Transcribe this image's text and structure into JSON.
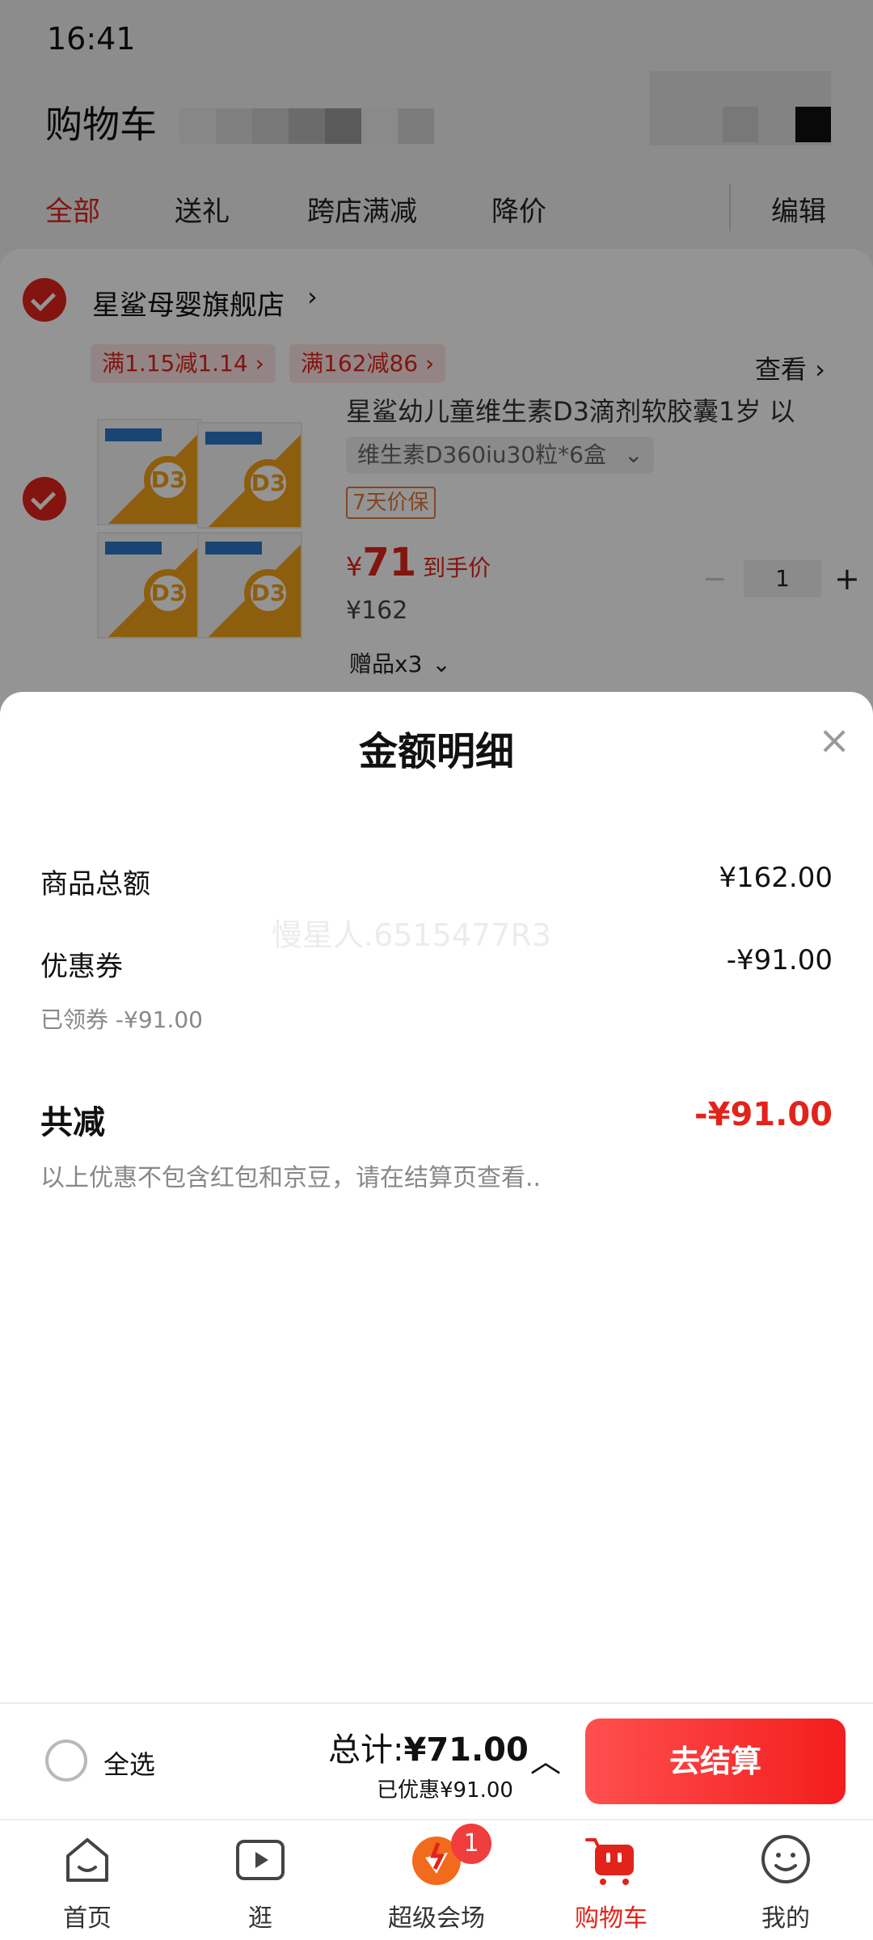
{
  "status_bar": {
    "time": "16:41"
  },
  "header": {
    "title": "购物车"
  },
  "tabs": [
    {
      "label": "全部",
      "active": true
    },
    {
      "label": "送礼"
    },
    {
      "label": "跨店满减"
    },
    {
      "label": "降价"
    },
    {
      "label": "编辑"
    }
  ],
  "store": {
    "name": "星鲨母婴旗舰店",
    "chevron": "›",
    "promos": [
      "满1.15减1.14 ›",
      "满162减86 ›"
    ],
    "view_label": "查看 ›"
  },
  "product": {
    "title": "星鲨幼儿童维生素D3滴剂软胶囊1岁 以",
    "sku": "维生素D360iu30粒*6盒",
    "sku_chevron": "⌄",
    "protection": "7天价保",
    "price_currency": "¥",
    "price_value": "71",
    "price_label": "到手价",
    "original_price": "¥162",
    "quantity": "1",
    "minus": "−",
    "plus": "+",
    "gift": "赠品x3",
    "gift_chevron": "⌄"
  },
  "sheet": {
    "title": "金额明细",
    "close": "×",
    "rows": [
      {
        "label": "商品总额",
        "value": "¥162.00"
      },
      {
        "label": "优惠券",
        "value": "-¥91.00",
        "sub": "已领券 -¥91.00"
      }
    ],
    "watermark": "慢星人.6515477R3",
    "total_label": "共减",
    "total_value": "-¥91.00",
    "note": "以上优惠不包含红包和京豆，请在结算页查看.."
  },
  "checkout": {
    "select_all": "全选",
    "total_prefix": "总计:",
    "total_amount": "¥71.00",
    "saved": "已优惠¥91.00",
    "expand": "︿",
    "button": "去结算"
  },
  "nav": [
    {
      "label": "首页",
      "icon": "home-icon"
    },
    {
      "label": "逛",
      "icon": "video-icon"
    },
    {
      "label": "超级会场",
      "icon": "super-venue-icon",
      "badge": "1"
    },
    {
      "label": "购物车",
      "icon": "cart-icon",
      "active": true
    },
    {
      "label": "我的",
      "icon": "profile-icon"
    }
  ],
  "colors": {
    "accent": "#e2231a",
    "overlay": "rgba(0,0,0,0.42)"
  }
}
